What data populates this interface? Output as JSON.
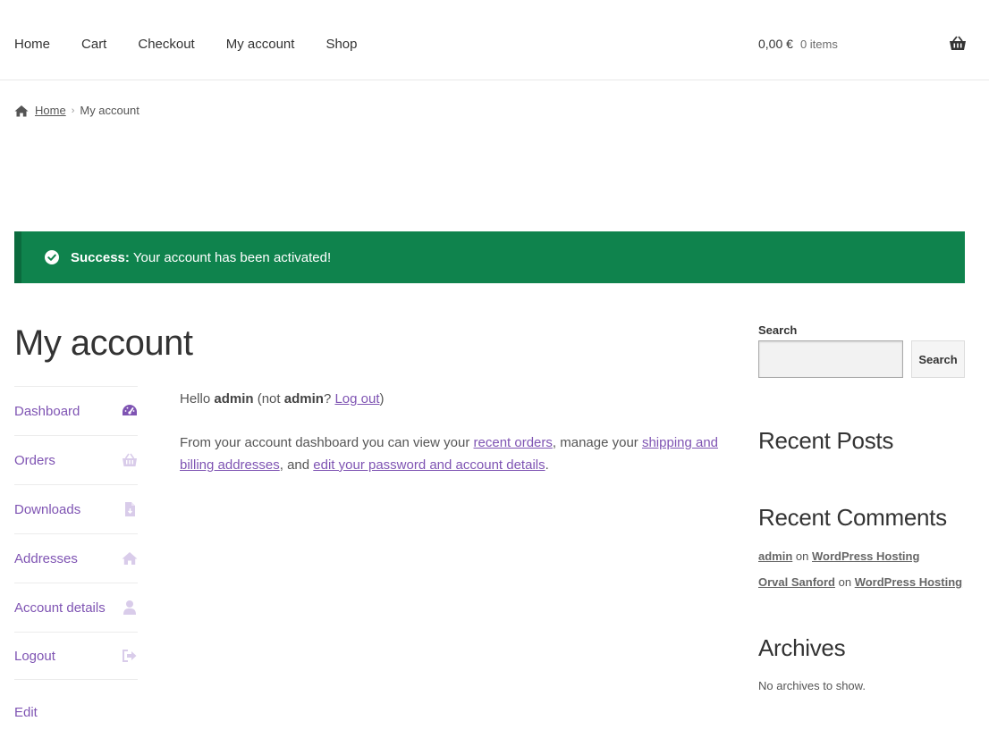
{
  "header": {
    "nav": [
      "Home",
      "Cart",
      "Checkout",
      "My account",
      "Shop"
    ],
    "cart_total": "0,00 €",
    "cart_count": "0 items"
  },
  "breadcrumb": {
    "home": "Home",
    "current": "My account"
  },
  "notice": {
    "strong": "Success:",
    "message": "Your account has been activated!",
    "color": "#0f834d"
  },
  "page_title": "My account",
  "account_nav": {
    "items": [
      {
        "label": "Dashboard",
        "icon": "dashboard-icon"
      },
      {
        "label": "Orders",
        "icon": "basket-icon"
      },
      {
        "label": "Downloads",
        "icon": "file-icon"
      },
      {
        "label": "Addresses",
        "icon": "home-icon"
      },
      {
        "label": "Account details",
        "icon": "user-icon"
      },
      {
        "label": "Logout",
        "icon": "sign-out-icon"
      }
    ],
    "accent": "#7f54b3"
  },
  "edit_link": "Edit",
  "content": {
    "hello": "Hello",
    "user": "admin",
    "not_prefix": "(not",
    "not_user": "admin",
    "not_q": "?",
    "logout": "Log out",
    "close_paren": ")",
    "p2_a": "From your account dashboard you can view your",
    "recent_orders": "recent orders",
    "p2_b": ", manage your",
    "addresses": "shipping and billing addresses",
    "p2_c": ", and",
    "details": "edit your password and account details",
    "p2_d": "."
  },
  "sidebar": {
    "search_label": "Search",
    "search_button": "Search",
    "recent_posts": "Recent Posts",
    "recent_comments": "Recent Comments",
    "comments": [
      {
        "author": "admin",
        "on": "on",
        "post": "WordPress Hosting"
      },
      {
        "author": "Orval Sanford",
        "on": "on",
        "post": "WordPress Hosting"
      }
    ],
    "archives": "Archives",
    "archives_empty": "No archives to show."
  }
}
